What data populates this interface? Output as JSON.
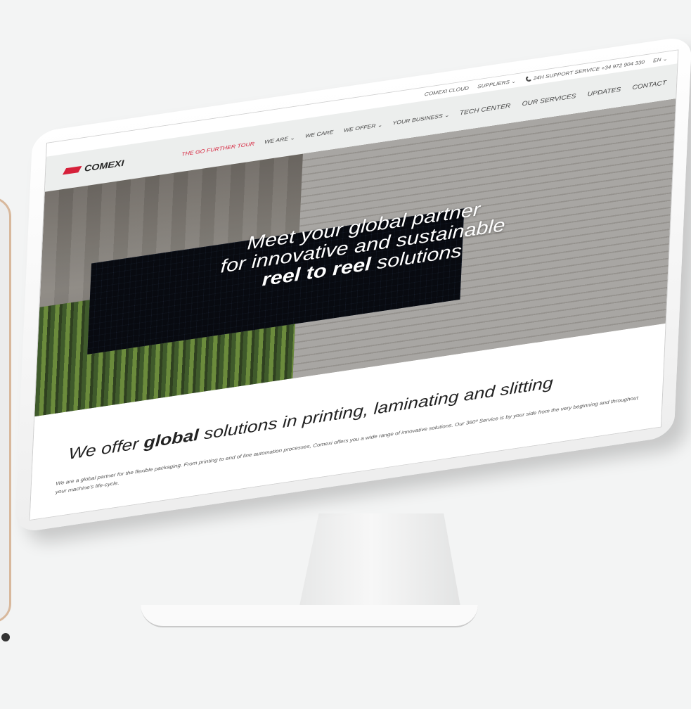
{
  "top_bar": {
    "items": [
      "COMEXI CLOUD",
      "SUPPLIERS ⌄",
      "📞 24H SUPPORT SERVICE +34 972 904 330",
      "EN ⌄"
    ]
  },
  "main_nav": {
    "logo_text": "COMEXI",
    "items": [
      {
        "label": "THE GO FURTHER TOUR",
        "highlight": true
      },
      {
        "label": "WE ARE ⌄"
      },
      {
        "label": "WE CARE"
      },
      {
        "label": "WE OFFER ⌄"
      },
      {
        "label": "YOUR BUSINESS ⌄"
      }
    ],
    "right_items": [
      "TECH CENTER",
      "OUR SERVICES",
      "UPDATES",
      "CONTACT"
    ]
  },
  "hero": {
    "line1": "Meet your global partner",
    "line2": "for innovative and sustainable",
    "line3_bold": "reel to reel",
    "line3_rest": " solutions"
  },
  "section": {
    "heading_pre": "We offer ",
    "heading_bold": "global",
    "heading_post": " solutions in printing, laminating and slitting",
    "paragraph": "We are a global partner for the flexible packaging. From printing to end of line automation processes, Comexi offers you a wide range of innovative solutions. Our 360º Service is by your side from the very beginning and throughout your machine's life-cycle."
  },
  "colors": {
    "accent": "#d6203a",
    "nav_bg": "#eceeed"
  }
}
